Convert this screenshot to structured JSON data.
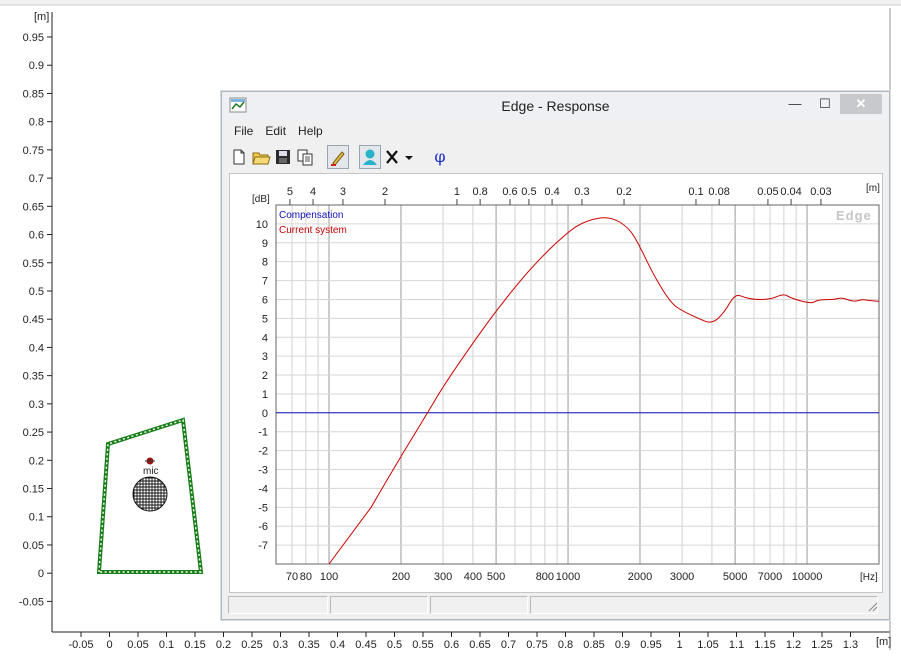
{
  "main_plot": {
    "y_unit": "[m]",
    "x_unit": "[m]",
    "y_ticks": [
      "0.95",
      "0.9",
      "0.85",
      "0.8",
      "0.75",
      "0.7",
      "0.65",
      "0.6",
      "0.55",
      "0.5",
      "0.45",
      "0.4",
      "0.35",
      "0.3",
      "0.25",
      "0.2",
      "0.15",
      "0.1",
      "0.05",
      "0",
      "-0.05"
    ],
    "x_ticks": [
      "-0.05",
      "0",
      "0.05",
      "0.1",
      "0.15",
      "0.2",
      "0.25",
      "0.3",
      "0.35",
      "0.4",
      "0.45",
      "0.5",
      "0.55",
      "0.6",
      "0.65",
      "0.7",
      "0.75",
      "0.8",
      "0.85",
      "0.9",
      "0.95",
      "1",
      "1.05",
      "1.1",
      "1.15",
      "1.2",
      "1.25",
      "1.3"
    ],
    "mic_label": "mic",
    "baffle_color": "#1a7f1a"
  },
  "window": {
    "title": "Edge - Response",
    "controls": {
      "minimize": "—",
      "maximize": "☐",
      "close": "✕"
    },
    "menu": [
      "File",
      "Edit",
      "Help"
    ],
    "toolbar_icons": [
      "new-file-icon",
      "open-folder-icon",
      "save-icon",
      "copy-icon",
      "pen-icon",
      "person-icon",
      "delete-icon",
      "dropdown-arrow-icon",
      "phase-icon"
    ],
    "phase_label": "φ"
  },
  "chart_data": {
    "type": "line",
    "watermark": "Edge",
    "ylabel": "[dB]",
    "ylim": [
      -8,
      11
    ],
    "y_ticks": [
      10,
      9,
      8,
      7,
      6,
      5,
      4,
      3,
      2,
      1,
      0,
      -1,
      -2,
      -3,
      -4,
      -5,
      -6,
      -7
    ],
    "xlabel": "[Hz]",
    "xscale": "log",
    "xlim": [
      60,
      20000
    ],
    "x_tick_labels": [
      {
        "value": 70,
        "label": "70"
      },
      {
        "value": 80,
        "label": "80"
      },
      {
        "value": 100,
        "label": "100"
      },
      {
        "value": 200,
        "label": "200"
      },
      {
        "value": 300,
        "label": "300"
      },
      {
        "value": 400,
        "label": "400"
      },
      {
        "value": 500,
        "label": "500"
      },
      {
        "value": 800,
        "label": "800"
      },
      {
        "value": 1000,
        "label": "1000"
      },
      {
        "value": 2000,
        "label": "2000"
      },
      {
        "value": 3000,
        "label": "3000"
      },
      {
        "value": 5000,
        "label": "5000"
      },
      {
        "value": 7000,
        "label": "7000"
      },
      {
        "value": 10000,
        "label": "10000"
      }
    ],
    "top_axis_unit": "[m]",
    "top_tick_labels": [
      "5",
      "4",
      "3",
      "2",
      "1",
      "0.8",
      "0.6",
      "0.5",
      "0.4",
      "0.3",
      "0.2",
      "0.1",
      "0.08",
      "0.05",
      "0.04",
      "0.03"
    ],
    "series": [
      {
        "name": "Compensation",
        "color": "#1010c0",
        "x": [
          60,
          20000
        ],
        "y": [
          0,
          0
        ]
      },
      {
        "name": "Current system",
        "color": "#cc0000",
        "x": [
          100,
          150,
          200,
          250,
          300,
          400,
          500,
          700,
          1000,
          1200,
          1500,
          1800,
          2000,
          2300,
          2700,
          3000,
          3500,
          4000,
          4500,
          5000,
          5500,
          6000,
          7000,
          8000,
          8500,
          9500,
          10500,
          11000,
          12000,
          13000,
          14000,
          15000,
          16000,
          17000,
          18000,
          20000
        ],
        "y": [
          -8,
          -5,
          -2.3,
          -0.3,
          1.4,
          3.7,
          5.4,
          7.7,
          9.6,
          10.2,
          10.4,
          9.8,
          8.8,
          7.2,
          5.8,
          5.4,
          5.0,
          4.7,
          5.3,
          6.3,
          6.1,
          6.0,
          6.0,
          6.3,
          6.1,
          5.9,
          5.8,
          5.95,
          6.0,
          6.0,
          6.1,
          5.95,
          5.9,
          6.0,
          5.95,
          5.9
        ]
      }
    ]
  }
}
